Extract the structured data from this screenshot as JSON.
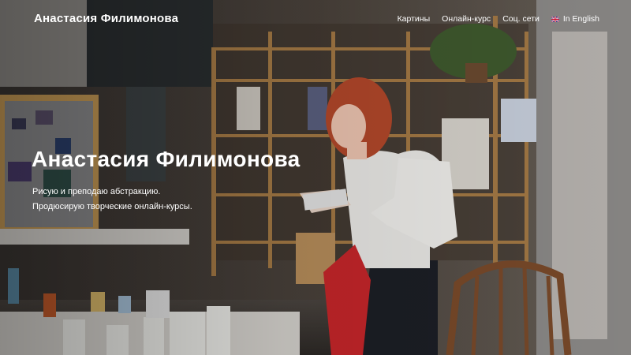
{
  "header": {
    "site_title": "Анастасия Филимонова",
    "nav": {
      "paintings": "Картины",
      "online_course": "Онлайн-курс",
      "social": "Соц. сети",
      "english": "In English"
    }
  },
  "hero": {
    "headline": "Анастасия Филимонова",
    "tagline_1": "Рисую и преподаю абстракцию.",
    "tagline_2": "Продюсирую творческие онлайн-курсы."
  },
  "icons": {
    "language_flag": "uk-flag-icon"
  }
}
